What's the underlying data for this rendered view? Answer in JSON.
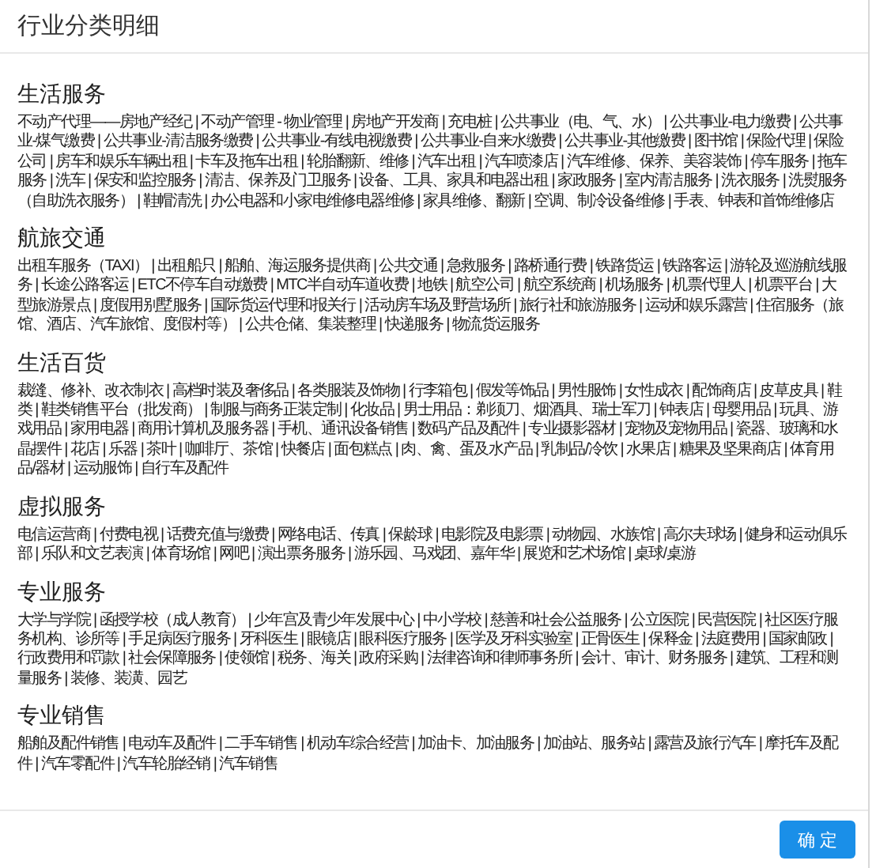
{
  "dialog": {
    "title": "行业分类明细"
  },
  "sections": [
    {
      "title": "生活服务",
      "text": "不动产代理——房地产经纪 | 不动产管理 - 物业管理 | 房地产开发商 | 充电桩 | 公共事业（电、气、水） | 公共事业-电力缴费 | 公共事业-煤气缴费 | 公共事业-清洁服务缴费 | 公共事业-有线电视缴费 | 公共事业-自来水缴费 | 公共事业-其他缴费 | 图书馆 | 保险代理 | 保险公司 | 房车和娱乐车辆出租 | 卡车及拖车出租 | 轮胎翻新、维修 | 汽车出租 | 汽车喷漆店 | 汽车维修、保养、美容装饰 | 停车服务 | 拖车服务 | 洗车 | 保安和监控服务 | 清洁、保养及门卫服务 | 设备、工具、家具和电器出租 | 家政服务 | 室内清洁服务 | 洗衣服务 | 洗熨服务（自助洗衣服务） | 鞋帽清洗 | 办公电器和小家电维修电器维修 | 家具维修、翻新 | 空调、制冷设备维修 | 手表、钟表和首饰维修店"
    },
    {
      "title": "航旅交通",
      "text": "出租车服务（TAXI） | 出租船只 | 船舶、海运服务提供商 | 公共交通 | 急救服务 | 路桥通行费 | 铁路货运 | 铁路客运 | 游轮及巡游航线服务 | 长途公路客运 | ETC不停车自动缴费 | MTC半自动车道收费 | 地铁 | 航空公司 | 航空系统商 | 机场服务 | 机票代理人 | 机票平台 | 大型旅游景点 | 度假用别墅服务 | 国际货运代理和报关行 | 活动房车场及野营场所 | 旅行社和旅游服务 | 运动和娱乐露营 | 住宿服务（旅馆、酒店、汽车旅馆、度假村等） | 公共仓储、集装整理 | 快递服务 | 物流货运服务"
    },
    {
      "title": "生活百货",
      "text": "裁缝、修补、改衣制衣 | 高档时装及奢侈品 | 各类服装及饰物 | 行李箱包 | 假发等饰品 | 男性服饰 | 女性成衣 | 配饰商店 | 皮草皮具 | 鞋类 | 鞋类销售平台（批发商） | 制服与商务正装定制 | 化妆品 | 男士用品：剃须刀、烟酒具、瑞士军刀 | 钟表店 | 母婴用品 | 玩具、游戏用品 | 家用电器 | 商用计算机及服务器 | 手机、通讯设备销售 | 数码产品及配件 | 专业摄影器材 | 宠物及宠物用品 | 瓷器、玻璃和水晶摆件 | 花店 | 乐器 | 茶叶 | 咖啡厅、茶馆 | 快餐店 | 面包糕点 | 肉、禽、蛋及水产品 | 乳制品/冷饮 | 水果店 | 糖果及坚果商店 | 体育用品/器材 | 运动服饰 | 自行车及配件"
    },
    {
      "title": "虚拟服务",
      "text": "电信运营商 | 付费电视 | 话费充值与缴费 | 网络电话、传真 | 保龄球 | 电影院及电影票 | 动物园、水族馆 | 高尔夫球场 | 健身和运动俱乐部 | 乐队和文艺表演 | 体育场馆 | 网吧 | 演出票务服务 | 游乐园、马戏团、嘉年华 | 展览和艺术场馆 | 桌球/桌游"
    },
    {
      "title": "专业服务",
      "text": "大学与学院 | 函授学校（成人教育） | 少年宫及青少年发展中心 | 中小学校 | 慈善和社会公益服务 | 公立医院 | 民营医院 | 社区医疗服务机构、诊所等 | 手足病医疗服务 | 牙科医生 | 眼镜店 | 眼科医疗服务 | 医学及牙科实验室 | 正骨医生 | 保释金 | 法庭费用 | 国家邮政 | 行政费用和罚款 | 社会保障服务 | 使领馆 | 税务、海关 | 政府采购 | 法律咨询和律师事务所 | 会计、审计、财务服务 | 建筑、工程和测量服务 | 装修、装潢、园艺"
    },
    {
      "title": "专业销售",
      "text": "船舶及配件销售 | 电动车及配件 | 二手车销售 | 机动车综合经营 | 加油卡、加油服务 | 加油站、服务站 | 露营及旅行汽车 | 摩托车及配件 | 汽车零配件 | 汽车轮胎经销 | 汽车销售"
    }
  ],
  "buttons": [
    {
      "label": "确 定"
    }
  ]
}
